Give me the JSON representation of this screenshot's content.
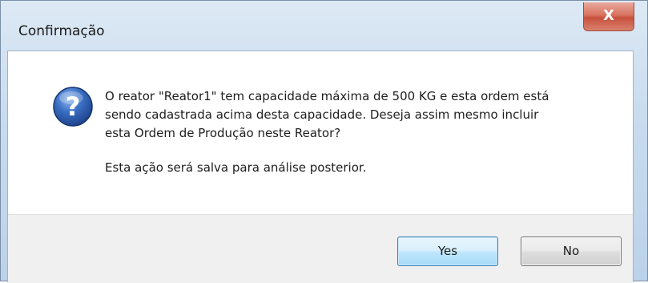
{
  "window": {
    "title": "Confirmação",
    "close_label": "X"
  },
  "icon": "question-icon",
  "message": {
    "lines": [
      "O reator \"Reator1\" tem capacidade máxima de 500 KG e esta ordem está",
      "sendo cadastrada acima desta capacidade. Deseja assim mesmo incluir",
      "esta Ordem de Produção neste Reator?"
    ],
    "note": "Esta ação será salva para análise posterior."
  },
  "buttons": {
    "yes_label": "Yes",
    "no_label": "No"
  },
  "colors": {
    "frame": "#c9dcee",
    "close": "#c7513d",
    "default_button_border": "#3c7fb1",
    "footer": "#f0f0f0",
    "icon_blue": "#2a5fb0"
  }
}
